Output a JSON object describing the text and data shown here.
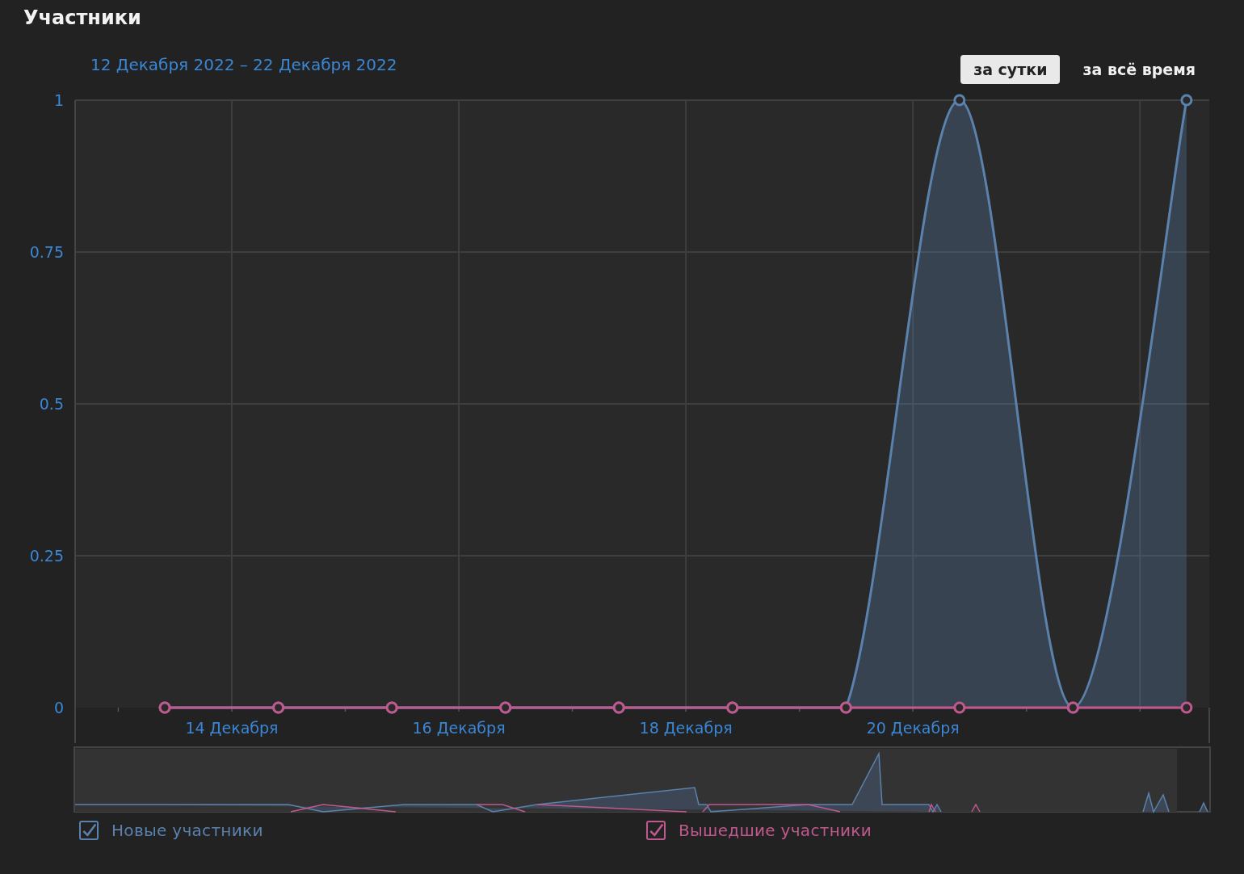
{
  "title": "Участники",
  "date_range": "12 Декабря 2022 – 22 Декабря 2022",
  "periods": [
    {
      "label": "за сутки",
      "selected": true
    },
    {
      "label": "за всё время",
      "selected": false
    }
  ],
  "chart": {
    "chart_data": {
      "type": "area",
      "x": [
        13.41,
        14.41,
        15.41,
        16.41,
        17.41,
        18.41,
        19.41,
        20.41,
        21.41,
        22.41
      ],
      "series": [
        {
          "name": "Новые участники",
          "color": "#5b82ad",
          "values": [
            0,
            0,
            0,
            0,
            0,
            0,
            0,
            1,
            0,
            1
          ]
        },
        {
          "name": "Вышедшие участники",
          "color": "#c0598e",
          "values": [
            0,
            0,
            0,
            0,
            0,
            0,
            0,
            0,
            0,
            0
          ]
        }
      ],
      "grid": true,
      "xlim": [
        12.62,
        22.61
      ],
      "ylim": [
        0,
        1
      ],
      "xticks": [
        {
          "value": 14,
          "label": "14 Декабря"
        },
        {
          "value": 16,
          "label": "16 Декабря"
        },
        {
          "value": 18,
          "label": "18 Декабря"
        },
        {
          "value": 20,
          "label": "20 Декабря"
        }
      ],
      "yticks": [
        0,
        0.25,
        0.5,
        0.75,
        1
      ]
    }
  },
  "legend": [
    {
      "checked": true
    },
    {
      "checked": true
    }
  ]
}
